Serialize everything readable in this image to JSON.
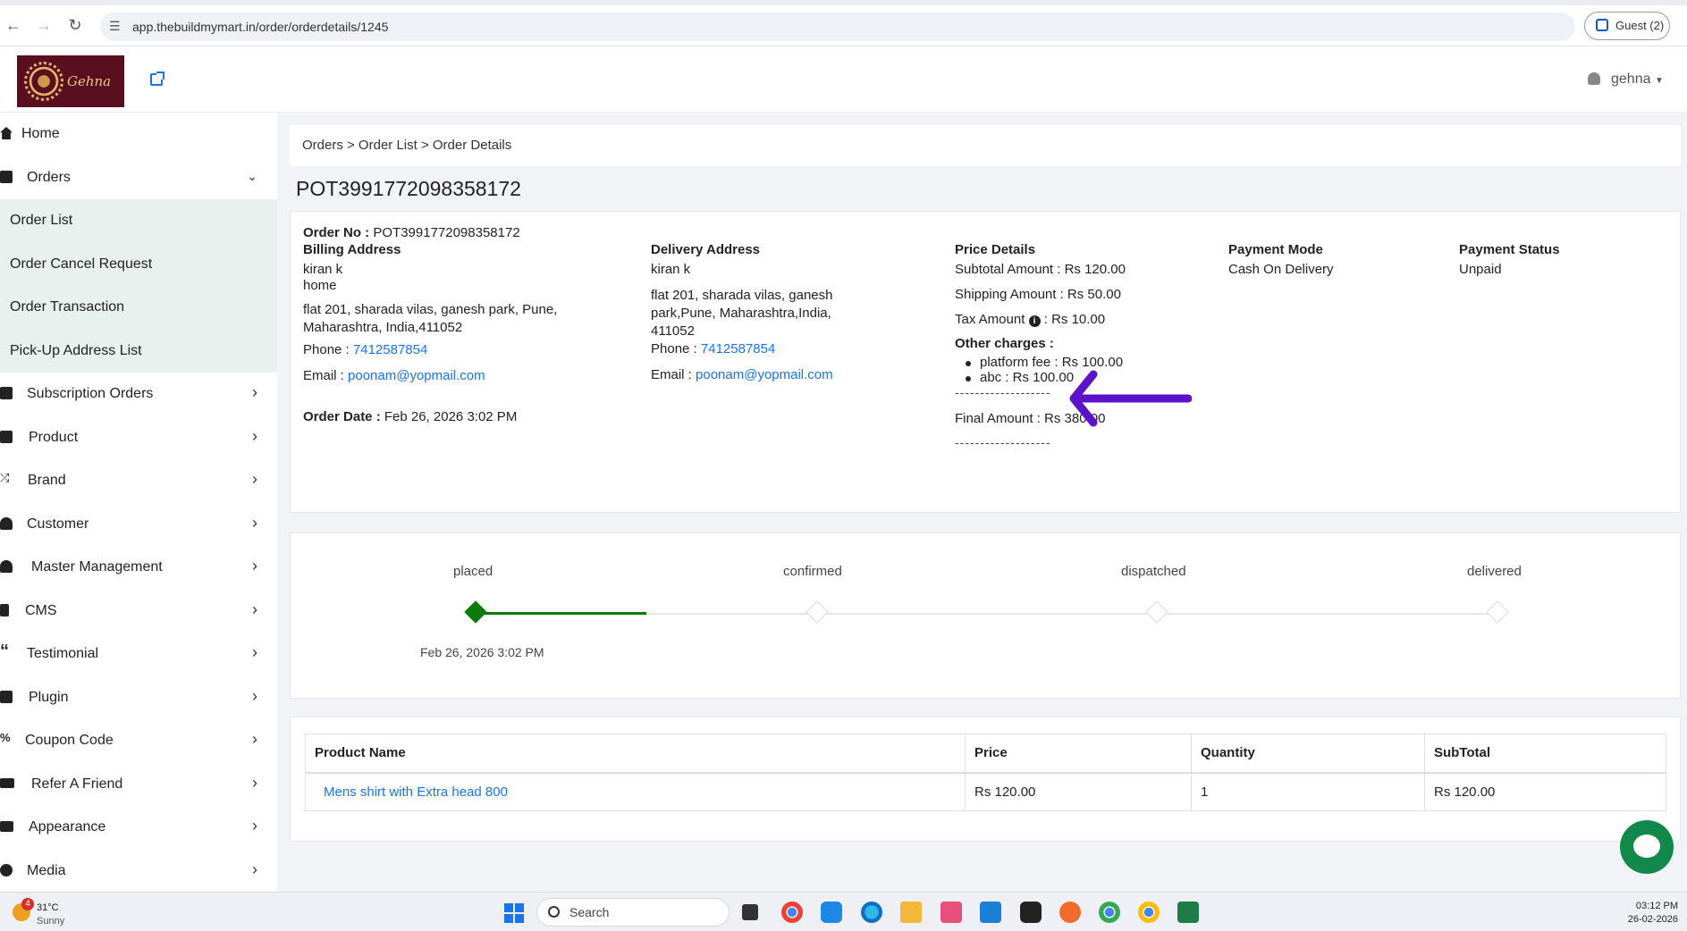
{
  "browser": {
    "url": "app.thebuildmymart.in/order/orderdetails/1245",
    "profile_label": "Guest (2)"
  },
  "header": {
    "logo_text": "Gehna",
    "user_name": "gehna"
  },
  "sidebar": {
    "items": [
      {
        "label": "Home",
        "icon": "home-icon"
      },
      {
        "label": "Orders",
        "icon": "bag-icon"
      }
    ],
    "orders_sub": [
      "Order List",
      "Order Cancel Request",
      "Order Transaction",
      "Pick-Up Address List"
    ],
    "rest": [
      {
        "label": "Subscription Orders",
        "icon": "bag-icon"
      },
      {
        "label": "Product",
        "icon": "archive-icon"
      },
      {
        "label": "Brand",
        "icon": "shuffle-icon"
      },
      {
        "label": "Customer",
        "icon": "user-icon"
      },
      {
        "label": "Master Management",
        "icon": "user-gear-icon"
      },
      {
        "label": "CMS",
        "icon": "file-icon"
      },
      {
        "label": "Testimonial",
        "icon": "quote-icon"
      },
      {
        "label": "Plugin",
        "icon": "puzzle-icon"
      },
      {
        "label": "Coupon Code",
        "icon": "percent-icon"
      },
      {
        "label": "Refer A Friend",
        "icon": "keyboard-icon"
      },
      {
        "label": "Appearance",
        "icon": "image-icon"
      },
      {
        "label": "Media",
        "icon": "play-icon"
      }
    ]
  },
  "breadcrumb": "Orders > Order List > Order Details",
  "order_title": "POT3991772098358172",
  "details": {
    "order_no_label": "Order No :",
    "order_no": "POT3991772098358172",
    "billing_label": "Billing Address",
    "billing_name": "kiran k",
    "billing_type": "home",
    "billing_address": "flat 201, sharada vilas, ganesh park, Pune, Maharashtra, India,411052",
    "billing_phone_label": "Phone :",
    "billing_phone": "7412587854",
    "billing_email_label": "Email :",
    "billing_email": "poonam@yopmail.com",
    "order_date_label": "Order Date :",
    "order_date": "Feb 26, 2026 3:02 PM",
    "delivery_label": "Delivery Address",
    "delivery_name": "kiran k",
    "delivery_address": "flat 201, sharada vilas, ganesh park,Pune, Maharashtra,India, 411052",
    "delivery_phone_label": "Phone :",
    "delivery_phone": "7412587854",
    "delivery_email_label": "Email :",
    "delivery_email": "poonam@yopmail.com",
    "price_label": "Price Details",
    "subtotal": "Subtotal Amount : Rs 120.00",
    "shipping": "Shipping Amount : Rs 50.00",
    "tax_label": "Tax Amount",
    "tax_value": ": Rs  10.00",
    "other_label": "Other charges :",
    "other_charges": [
      "platform fee :  Rs  100.00",
      "abc :  Rs  100.00"
    ],
    "dashes": "-------------------",
    "final": "Final Amount : Rs  380.00",
    "payment_mode_label": "Payment Mode",
    "payment_mode": "Cash On Delivery",
    "payment_status_label": "Payment Status",
    "payment_status": "Unpaid"
  },
  "tracker": {
    "steps": [
      "placed",
      "confirmed",
      "dispatched",
      "delivered"
    ],
    "completed_steps": 1,
    "placed_date": "Feb 26, 2026 3:02 PM",
    "accent": "#0a7a0a"
  },
  "products": {
    "headers": [
      "Product Name",
      "Price",
      "Quantity",
      "SubTotal"
    ],
    "rows": [
      [
        "Mens shirt with Extra head 800",
        "Rs 120.00",
        "1",
        "Rs 120.00"
      ]
    ]
  },
  "annotation_color": "#5b12c9",
  "taskbar": {
    "temp": "31°C",
    "weather": "Sunny",
    "badge": "4",
    "search": "Search",
    "time": "03:12 PM",
    "date": "26-02-2026"
  }
}
